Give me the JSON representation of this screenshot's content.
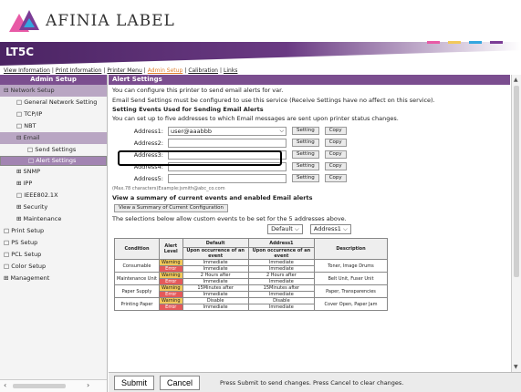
{
  "logo": {
    "text": "AFINIA LABEL"
  },
  "banner": {
    "title": "LT5C"
  },
  "colors": {
    "purple": "#7b4e8f",
    "dash_colors": [
      "#e85aa6",
      "#f2c95b",
      "#34a6df",
      "#7b3c96"
    ]
  },
  "topnav": [
    {
      "label": "View Information",
      "active": false
    },
    {
      "label": "Print Information",
      "active": false
    },
    {
      "label": "Printer Menu",
      "active": false
    },
    {
      "label": "Admin Setup",
      "active": true
    },
    {
      "label": "Calibration",
      "active": false
    },
    {
      "label": "Links",
      "active": false
    }
  ],
  "sidebar": {
    "header": "Admin Setup",
    "items": [
      {
        "label": "Network Setup",
        "level": "l0",
        "type": "group",
        "icon": "minus-icon"
      },
      {
        "label": "General Network Setting",
        "level": "l1",
        "type": "",
        "icon": "page-icon"
      },
      {
        "label": "TCP/IP",
        "level": "l1",
        "type": "",
        "icon": "page-icon"
      },
      {
        "label": "NBT",
        "level": "l1",
        "type": "",
        "icon": "page-icon"
      },
      {
        "label": "Email",
        "level": "l1",
        "type": "group",
        "icon": "minus-icon"
      },
      {
        "label": "Send Settings",
        "level": "l2",
        "type": "",
        "icon": "page-icon"
      },
      {
        "label": "Alert Settings",
        "level": "l2",
        "type": "sel",
        "icon": "page-icon"
      },
      {
        "label": "SNMP",
        "level": "l1",
        "type": "",
        "icon": "plus-icon"
      },
      {
        "label": "IPP",
        "level": "l1",
        "type": "",
        "icon": "plus-icon"
      },
      {
        "label": "IEEE802.1X",
        "level": "l1",
        "type": "",
        "icon": "page-icon"
      },
      {
        "label": "Security",
        "level": "l1",
        "type": "",
        "icon": "plus-icon"
      },
      {
        "label": "Maintenance",
        "level": "l1",
        "type": "",
        "icon": "plus-icon"
      },
      {
        "label": "Print Setup",
        "level": "l0",
        "type": "",
        "icon": "page-icon"
      },
      {
        "label": "PS Setup",
        "level": "l0",
        "type": "",
        "icon": "page-icon"
      },
      {
        "label": "PCL Setup",
        "level": "l0",
        "type": "",
        "icon": "page-icon"
      },
      {
        "label": "Color Setup",
        "level": "l0",
        "type": "",
        "icon": "page-icon"
      },
      {
        "label": "Management",
        "level": "l0",
        "type": "",
        "icon": "plus-icon"
      }
    ]
  },
  "content": {
    "section1": "Alert Settings",
    "p1": "You can configure this printer to send email alerts for var.",
    "p2": "Email Send Settings must be configured to use this service (Receive Settings have no affect on this service).",
    "p3_bold": "Setting Events Used for Sending Email Alerts",
    "p4": "You can set up to five addresses to which Email messages are sent upon printer status changes.",
    "addresses": [
      {
        "label": "Address1:",
        "value": "user@aaabbb"
      },
      {
        "label": "Address2:",
        "value": ""
      },
      {
        "label": "Address3:",
        "value": ""
      },
      {
        "label": "Address4:",
        "value": ""
      },
      {
        "label": "Address5:",
        "value": ""
      }
    ],
    "setting_label": "Setting",
    "copy_label": "Copy",
    "hint": "(Max.78 characters)Example:jsmith@abc_co.com",
    "section2": "View a summary of current events and enabled Email alerts",
    "summary_btn": "View a Summary of Current Configuration",
    "p5": "The selections below allow custom events to be set for the 5 addresses above.",
    "select1": "Default",
    "select2": "Address1",
    "table": {
      "h_condition": "Condition",
      "h_level": "Alert Level",
      "h_default": "Default",
      "h_addr1": "Address1",
      "h_sub": "Upon occurrence of an event",
      "h_desc": "Description",
      "rows": [
        {
          "condition": "Consumable",
          "levels": [
            "Warning",
            "Error"
          ],
          "def": [
            "Immediate",
            "Immediate"
          ],
          "addr": [
            "Immediate",
            "Immediate"
          ],
          "desc": "Toner, Image Drums"
        },
        {
          "condition": "Maintenance Unit",
          "levels": [
            "Warning",
            "Error"
          ],
          "def": [
            "2 Hours after",
            "Immediate"
          ],
          "addr": [
            "2 Hours after",
            "Immediate"
          ],
          "desc": "Belt Unit, Fuser Unit"
        },
        {
          "condition": "Paper Supply",
          "levels": [
            "Warning",
            "Error"
          ],
          "def": [
            "15Minutes after",
            "Immediate"
          ],
          "addr": [
            "15Minutes after",
            "Immediate"
          ],
          "desc": "Paper, Transparencies"
        },
        {
          "condition": "Printing Paper",
          "levels": [
            "Warning",
            "Error"
          ],
          "def": [
            "Disable",
            "Immediate"
          ],
          "addr": [
            "Disable",
            "Immediate"
          ],
          "desc": "Cover Open, Paper Jam"
        }
      ]
    }
  },
  "footer": {
    "submit": "Submit",
    "cancel": "Cancel",
    "text": "Press Submit to send changes. Press Cancel to clear changes."
  }
}
